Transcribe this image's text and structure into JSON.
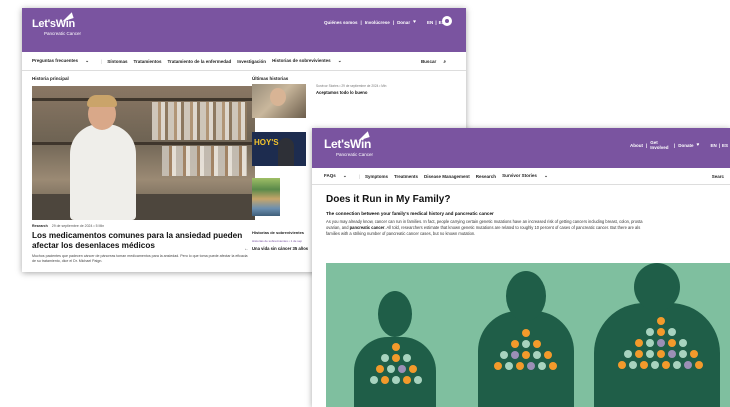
{
  "spanish_page": {
    "logo": {
      "word": "Let'sWin",
      "sub": "Pancreatic Cancer"
    },
    "header_links": {
      "about": "Quiénes somos",
      "sep1": "|",
      "involved": "Involúcrese",
      "sep2": "|",
      "donate": "Donar",
      "lang_en": "EN",
      "lang_sep": "|",
      "lang_es": "ES"
    },
    "nav": {
      "faq": "Preguntas frecuentes",
      "symptoms": "Síntomas",
      "treatments": "Tratamientos",
      "disease_mgmt": "Tratamiento de la enfermedad",
      "research": "Investigación",
      "stories": "Historias de sobrevivientes",
      "search": "Buscar"
    },
    "main_story_label": "Historia principal",
    "latest_label": "Últimas historias",
    "main_meta_tag": "Research",
    "main_meta_date": "29 de septiembre de 2024 • 5 Min",
    "main_headline": "Los medicamentos comunes para la ansiedad pueden afectar los desenlaces médicos",
    "main_deck": "Muchos pacientes que padecen cáncer de páncreas toman medicamentos para la ansiedad. Pero lo que toma puede afectar la eficacia de su tratamiento, dice el Dr. Michael Paign.",
    "latest": {
      "meta": "Survivor Stories • 29 de septiembre de 2024 • Min",
      "title": "Aceptamos todo lo bueno"
    },
    "tv_text": "HOY'S",
    "survivor_label": "Historias de sobrevivientes",
    "survivor_meta": "Historias de sobrevivientes • 1 de sep",
    "survivor_title": "Una vida sin cáncer 35 años"
  },
  "english_page": {
    "logo": {
      "word": "Let'sWin",
      "sub": "Pancreatic Cancer"
    },
    "header_links": {
      "about": "About",
      "sep1": "|",
      "involved": "Get Involved",
      "sep2": "|",
      "donate": "Donate",
      "lang_en": "EN",
      "lang_sep": "|",
      "lang_es": "ES"
    },
    "nav": {
      "faqs": "FAQs",
      "symptoms": "Symptoms",
      "treatments": "Treatments",
      "disease_mgmt": "Disease Management",
      "research": "Research",
      "stories": "Survivor Stories",
      "search": "Searc"
    },
    "title": "Does it Run in My Family?",
    "subhead": "The connection between your family's medical history and pancreatic cancer",
    "body_a": "As you may already know, cancer can run in families. In fact, people carrying certain genetic mutations have an increased risk of getting cancers including breast, colon, prosta",
    "body_b": "ovarian, and ",
    "body_bold": "pancreatic cancer",
    "body_c": ". All told, researchers estimate that known genetic mutations are related to roughly 10 percent of cases of pancreatic cancer. But there are als",
    "body_d": "families with a striking number of pancreatic cancer cases, but no known mutation."
  },
  "colors": {
    "brand_purple": "#7a54a0",
    "illustration_green": "#7fbf9f",
    "silhouette_green": "#1f5e48",
    "node_orange": "#f39a2b"
  },
  "icons": {
    "heart": "heart-icon",
    "user": "user-icon",
    "search": "search-icon",
    "chevron": "chevron-down-icon",
    "arrow": "arrow-left-icon"
  }
}
